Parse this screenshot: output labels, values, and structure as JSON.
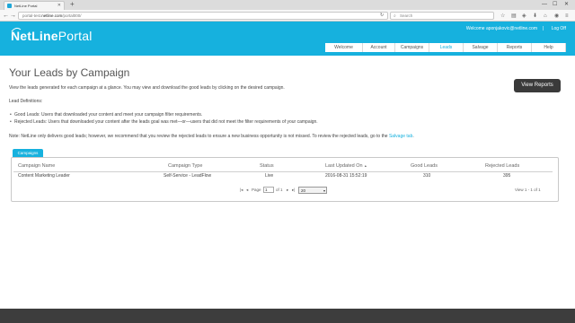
{
  "browser": {
    "tab_title": "NetLine Portal",
    "new_tab_icon": "+",
    "window_controls": [
      "—",
      "☐",
      "✕"
    ],
    "url_prefix": "portal-test.",
    "url_host": "netline.com",
    "url_path": "/portal000/",
    "search_placeholder": "Search"
  },
  "header": {
    "logo_net": "NetLine",
    "logo_portal": "Portal",
    "user_email": "Welcome aponjakovic@netline.com",
    "separator": "|",
    "logout_label": "Log Off",
    "nav": [
      {
        "label": "Welcome"
      },
      {
        "label": "Account"
      },
      {
        "label": "Campaigns"
      },
      {
        "label": "Leads",
        "active": true
      },
      {
        "label": "Salvage"
      },
      {
        "label": "Reports"
      },
      {
        "label": "Help"
      }
    ],
    "accent_color": "#16b1de"
  },
  "main": {
    "title": "Your Leads by Campaign",
    "view_reports_label": "View Reports",
    "intro": "View the leads generated for each campaign at a glance. You may view and download the good leads by clicking on the desired campaign.",
    "definitions_heading": "Lead Definitions:",
    "definition_good": "Good Leads: Users that downloaded your content and meet your campaign filter requirements.",
    "definition_rejected": "Rejected Leads: Users that downloaded your content after the leads goal was met—or—users that did not meet the filter requirements of your campaign.",
    "note": "Note: NetLine only delivers good leads; however, we recommend that you review the rejected leads to ensure a new business opportunity is not missed. To review the rejected leads, go to the",
    "note_link": "Salvage tab",
    "note_end": "."
  },
  "campaigns": {
    "tab_label": "Campaigns",
    "columns": [
      "Campaign Name",
      "Campaign Type",
      "Status",
      "Last Updated On",
      "Good Leads",
      "Rejected Leads"
    ],
    "sort_indicator": "▲",
    "rows": [
      {
        "name": "Content Marketing Leader",
        "type": "Self-Service - LeadFlow",
        "status": "Live",
        "updated": "2016-08-31 15:52:19",
        "good": "310",
        "rejected": "395"
      }
    ],
    "pager": {
      "first": "|◂",
      "prev": "◂",
      "page_label": "Page",
      "page_value": "1",
      "of_label": "of 1",
      "next": "▸",
      "last": "▸|",
      "per_page": "20",
      "summary": "View 1 - 1 of 1"
    }
  }
}
